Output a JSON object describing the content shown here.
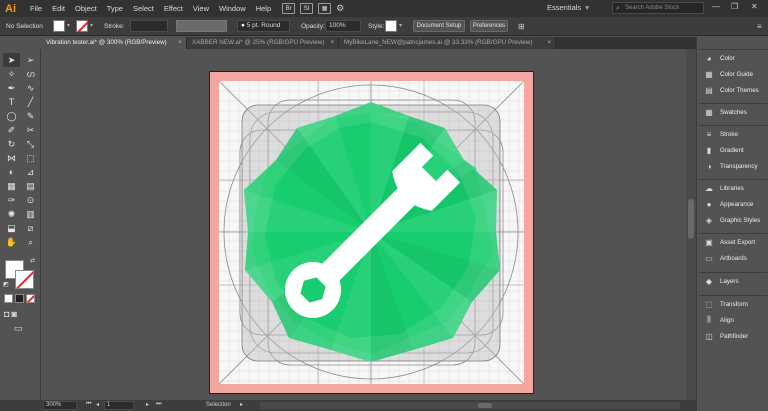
{
  "app": {
    "logo": "Ai"
  },
  "menu": [
    "File",
    "Edit",
    "Object",
    "Type",
    "Select",
    "Effect",
    "View",
    "Window",
    "Help"
  ],
  "menubar_icons": {
    "bridge": "Br",
    "stock": "St"
  },
  "workspace": {
    "label": "Essentials"
  },
  "stock_search": {
    "placeholder": "Search Adobe Stock"
  },
  "control": {
    "selection_label": "No Selection",
    "stroke_label": "Stroke:",
    "brush": "5 pt. Round",
    "opacity_label": "Opacity:",
    "opacity_value": "100%",
    "style_label": "Style:",
    "doc_setup": "Document Setup",
    "preferences": "Preferences"
  },
  "tabs": [
    {
      "label": "Vibration tester.ai* @ 300% (RGB/Preview)",
      "active": true
    },
    {
      "label": "XABBER NEW.ai* @ 25% (RGB/GPU Preview)",
      "active": false
    },
    {
      "label": "MyBikeLane_NEW@patricjames.ai @ 33.33% (RGB/GPU Preview)",
      "active": false
    }
  ],
  "panels": [
    {
      "group": 1,
      "items": [
        {
          "label": "Color",
          "icon": "color-icon"
        },
        {
          "label": "Color Guide",
          "icon": "color-guide-icon"
        },
        {
          "label": "Color Themes",
          "icon": "color-themes-icon"
        }
      ]
    },
    {
      "group": 2,
      "items": [
        {
          "label": "Swatches",
          "icon": "swatches-icon"
        }
      ]
    },
    {
      "group": 3,
      "items": [
        {
          "label": "Stroke",
          "icon": "stroke-icon"
        },
        {
          "label": "Gradient",
          "icon": "gradient-icon"
        },
        {
          "label": "Transparency",
          "icon": "transparency-icon"
        }
      ]
    },
    {
      "group": 4,
      "items": [
        {
          "label": "Libraries",
          "icon": "libraries-icon"
        },
        {
          "label": "Appearance",
          "icon": "appearance-icon"
        },
        {
          "label": "Graphic Styles",
          "icon": "graphic-styles-icon"
        }
      ]
    },
    {
      "group": 5,
      "items": [
        {
          "label": "Asset Export",
          "icon": "asset-export-icon"
        },
        {
          "label": "Artboards",
          "icon": "artboards-icon"
        }
      ]
    },
    {
      "group": 6,
      "items": [
        {
          "label": "Layers",
          "icon": "layers-icon"
        }
      ]
    },
    {
      "group": 7,
      "items": [
        {
          "label": "Transform",
          "icon": "transform-icon"
        },
        {
          "label": "Align",
          "icon": "align-icon"
        },
        {
          "label": "Pathfinder",
          "icon": "pathfinder-icon"
        }
      ]
    }
  ],
  "status": {
    "zoom": "300%",
    "artboard": "1",
    "tool": "Selection"
  },
  "colors": {
    "accent_green": "#10cc6c",
    "bleed_red": "#f4a6a0",
    "ai_orange": "#ff9a00"
  },
  "artwork": {
    "subject": "wrench-icon"
  }
}
